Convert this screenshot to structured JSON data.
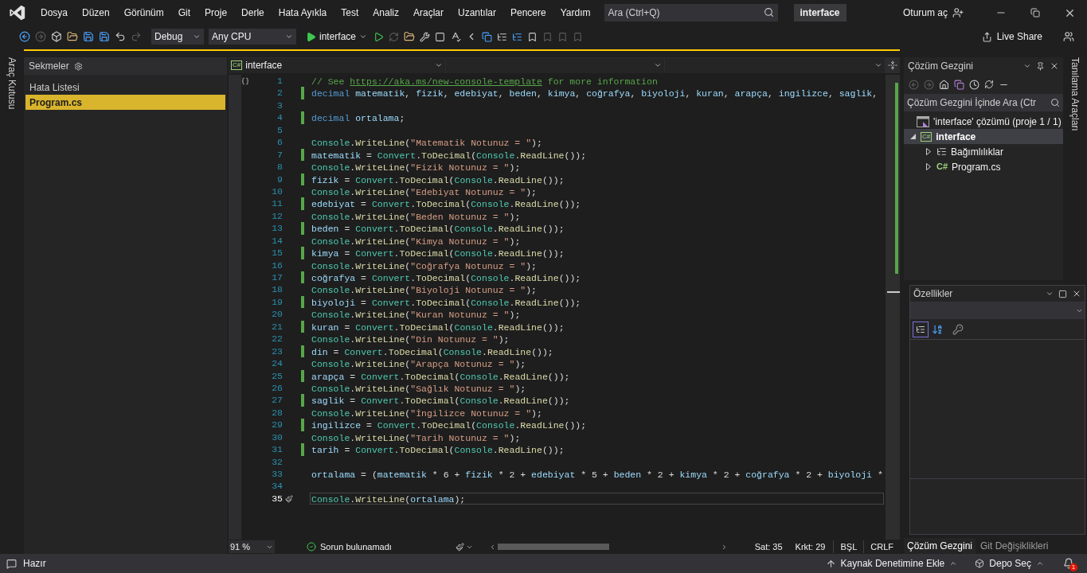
{
  "menu": [
    "Dosya",
    "Düzen",
    "Görünüm",
    "Git",
    "Proje",
    "Derle",
    "Hata Ayıkla",
    "Test",
    "Analiz",
    "Araçlar",
    "Uzantılar",
    "Pencere",
    "Yardım"
  ],
  "search": {
    "placeholder": "Ara (Ctrl+Q)"
  },
  "solution_name": "interface",
  "sign_in": "Oturum aç",
  "toolbar": {
    "configuration": "Debug",
    "platform": "Any CPU",
    "run_target": "interface",
    "live_share": "Live Share"
  },
  "left_rail": {
    "label": "Araç Kutusu"
  },
  "tabs_panel": {
    "title": "Sekmeler",
    "items": [
      {
        "label": "Hata Listesi",
        "selected": false
      },
      {
        "label": "Program.cs",
        "selected": true
      }
    ]
  },
  "editor": {
    "file_icon": "C#",
    "file": "interface",
    "lines": [
      {
        "number": "1",
        "changed": false,
        "current": false,
        "tokens": [
          {
            "kind": "comment",
            "text": "// See "
          },
          {
            "kind": "link",
            "text": "https://aka.ms/new-console-template"
          },
          {
            "kind": "comment",
            "text": " for more information"
          }
        ]
      },
      {
        "number": "2",
        "changed": true,
        "current": false,
        "tokens": [
          {
            "kind": "kw",
            "text": "decimal"
          },
          {
            "kind": "var",
            "text": "matematik"
          },
          {
            "kind": "punct",
            "text": ", "
          },
          {
            "kind": "var",
            "text": "fizik"
          },
          {
            "kind": "punct",
            "text": ", "
          },
          {
            "kind": "var",
            "text": "edebiyat"
          },
          {
            "kind": "punct",
            "text": ", "
          },
          {
            "kind": "var",
            "text": "beden"
          },
          {
            "kind": "punct",
            "text": ", "
          },
          {
            "kind": "var",
            "text": "kimya"
          },
          {
            "kind": "punct",
            "text": ", "
          },
          {
            "kind": "var",
            "text": "coğrafya"
          },
          {
            "kind": "punct",
            "text": ", "
          },
          {
            "kind": "var",
            "text": "biyoloji"
          },
          {
            "kind": "punct",
            "text": ", "
          },
          {
            "kind": "var",
            "text": "kuran"
          },
          {
            "kind": "punct",
            "text": ", "
          },
          {
            "kind": "var",
            "text": "arapça"
          },
          {
            "kind": "punct",
            "text": ", "
          },
          {
            "kind": "var",
            "text": "ingilizce"
          },
          {
            "kind": "punct",
            "text": ", "
          },
          {
            "kind": "var",
            "text": "saglik"
          },
          {
            "kind": "punct",
            "text": ","
          }
        ]
      },
      {
        "number": "3",
        "changed": false,
        "current": false
      },
      {
        "number": "4",
        "changed": true,
        "current": false,
        "tokens": [
          {
            "kind": "kw",
            "text": "decimal"
          },
          {
            "kind": "var",
            "text": "ortalama"
          },
          {
            "kind": "punct",
            "text": ";"
          }
        ]
      },
      {
        "number": "5",
        "changed": false,
        "current": false
      },
      {
        "number": "6",
        "changed": false,
        "current": false,
        "tokens": [
          {
            "kind": "type",
            "text": "Console"
          },
          {
            "kind": "punct",
            "text": "."
          },
          {
            "kind": "method",
            "text": "WriteLine"
          },
          {
            "kind": "punct",
            "text": "("
          },
          {
            "kind": "str",
            "text": "\"Matematik Notunuz = \""
          },
          {
            "kind": "punct",
            "text": ");"
          }
        ]
      },
      {
        "number": "7",
        "changed": true,
        "current": false,
        "tokens": [
          {
            "kind": "var",
            "text": "matematik"
          },
          {
            "kind": "punct",
            "text": " = "
          },
          {
            "kind": "type",
            "text": "Convert"
          },
          {
            "kind": "punct",
            "text": "."
          },
          {
            "kind": "method",
            "text": "ToDecimal"
          },
          {
            "kind": "punct",
            "text": "("
          },
          {
            "kind": "type",
            "text": "Console"
          },
          {
            "kind": "punct",
            "text": "."
          },
          {
            "kind": "method",
            "text": "ReadLine"
          },
          {
            "kind": "punct",
            "text": "());"
          }
        ]
      },
      {
        "number": "8",
        "changed": false,
        "current": false,
        "tokens": [
          {
            "kind": "type",
            "text": "Console"
          },
          {
            "kind": "punct",
            "text": "."
          },
          {
            "kind": "method",
            "text": "WriteLine"
          },
          {
            "kind": "punct",
            "text": "("
          },
          {
            "kind": "str",
            "text": "\"Fizik Notunuz = \""
          },
          {
            "kind": "punct",
            "text": ");"
          }
        ]
      },
      {
        "number": "9",
        "changed": true,
        "current": false,
        "tokens": [
          {
            "kind": "var",
            "text": "fizik"
          },
          {
            "kind": "punct",
            "text": " = "
          },
          {
            "kind": "type",
            "text": "Convert"
          },
          {
            "kind": "punct",
            "text": "."
          },
          {
            "kind": "method",
            "text": "ToDecimal"
          },
          {
            "kind": "punct",
            "text": "("
          },
          {
            "kind": "type",
            "text": "Console"
          },
          {
            "kind": "punct",
            "text": "."
          },
          {
            "kind": "method",
            "text": "ReadLine"
          },
          {
            "kind": "punct",
            "text": "());"
          }
        ]
      },
      {
        "number": "10",
        "changed": false,
        "current": false,
        "tokens": [
          {
            "kind": "type",
            "text": "Console"
          },
          {
            "kind": "punct",
            "text": "."
          },
          {
            "kind": "method",
            "text": "WriteLine"
          },
          {
            "kind": "punct",
            "text": "("
          },
          {
            "kind": "str",
            "text": "\"Edebiyat Notunuz = \""
          },
          {
            "kind": "punct",
            "text": ");"
          }
        ]
      },
      {
        "number": "11",
        "changed": true,
        "current": false,
        "tokens": [
          {
            "kind": "var",
            "text": "edebiyat"
          },
          {
            "kind": "punct",
            "text": " = "
          },
          {
            "kind": "type",
            "text": "Convert"
          },
          {
            "kind": "punct",
            "text": "."
          },
          {
            "kind": "method",
            "text": "ToDecimal"
          },
          {
            "kind": "punct",
            "text": "("
          },
          {
            "kind": "type",
            "text": "Console"
          },
          {
            "kind": "punct",
            "text": "."
          },
          {
            "kind": "method",
            "text": "ReadLine"
          },
          {
            "kind": "punct",
            "text": "());"
          }
        ]
      },
      {
        "number": "12",
        "changed": false,
        "current": false,
        "tokens": [
          {
            "kind": "type",
            "text": "Console"
          },
          {
            "kind": "punct",
            "text": "."
          },
          {
            "kind": "method",
            "text": "WriteLine"
          },
          {
            "kind": "punct",
            "text": "("
          },
          {
            "kind": "str",
            "text": "\"Beden Notunuz = \""
          },
          {
            "kind": "punct",
            "text": ");"
          }
        ]
      },
      {
        "number": "13",
        "changed": true,
        "current": false,
        "tokens": [
          {
            "kind": "var",
            "text": "beden"
          },
          {
            "kind": "punct",
            "text": " = "
          },
          {
            "kind": "type",
            "text": "Convert"
          },
          {
            "kind": "punct",
            "text": "."
          },
          {
            "kind": "method",
            "text": "ToDecimal"
          },
          {
            "kind": "punct",
            "text": "("
          },
          {
            "kind": "type",
            "text": "Console"
          },
          {
            "kind": "punct",
            "text": "."
          },
          {
            "kind": "method",
            "text": "ReadLine"
          },
          {
            "kind": "punct",
            "text": "());"
          }
        ]
      },
      {
        "number": "14",
        "changed": false,
        "current": false,
        "tokens": [
          {
            "kind": "type",
            "text": "Console"
          },
          {
            "kind": "punct",
            "text": "."
          },
          {
            "kind": "method",
            "text": "WriteLine"
          },
          {
            "kind": "punct",
            "text": "("
          },
          {
            "kind": "str",
            "text": "\"Kimya Notunuz = \""
          },
          {
            "kind": "punct",
            "text": ");"
          }
        ]
      },
      {
        "number": "15",
        "changed": true,
        "current": false,
        "tokens": [
          {
            "kind": "var",
            "text": "kimya"
          },
          {
            "kind": "punct",
            "text": " = "
          },
          {
            "kind": "type",
            "text": "Convert"
          },
          {
            "kind": "punct",
            "text": "."
          },
          {
            "kind": "method",
            "text": "ToDecimal"
          },
          {
            "kind": "punct",
            "text": "("
          },
          {
            "kind": "type",
            "text": "Console"
          },
          {
            "kind": "punct",
            "text": "."
          },
          {
            "kind": "method",
            "text": "ReadLine"
          },
          {
            "kind": "punct",
            "text": "());"
          }
        ]
      },
      {
        "number": "16",
        "changed": false,
        "current": false,
        "tokens": [
          {
            "kind": "type",
            "text": "Console"
          },
          {
            "kind": "punct",
            "text": "."
          },
          {
            "kind": "method",
            "text": "WriteLine"
          },
          {
            "kind": "punct",
            "text": "("
          },
          {
            "kind": "str",
            "text": "\"Coğrafya Notunuz = \""
          },
          {
            "kind": "punct",
            "text": ");"
          }
        ]
      },
      {
        "number": "17",
        "changed": true,
        "current": false,
        "tokens": [
          {
            "kind": "var",
            "text": "coğrafya"
          },
          {
            "kind": "punct",
            "text": " = "
          },
          {
            "kind": "type",
            "text": "Convert"
          },
          {
            "kind": "punct",
            "text": "."
          },
          {
            "kind": "method",
            "text": "ToDecimal"
          },
          {
            "kind": "punct",
            "text": "("
          },
          {
            "kind": "type",
            "text": "Console"
          },
          {
            "kind": "punct",
            "text": "."
          },
          {
            "kind": "method",
            "text": "ReadLine"
          },
          {
            "kind": "punct",
            "text": "());"
          }
        ]
      },
      {
        "number": "18",
        "changed": false,
        "current": false,
        "tokens": [
          {
            "kind": "type",
            "text": "Console"
          },
          {
            "kind": "punct",
            "text": "."
          },
          {
            "kind": "method",
            "text": "WriteLine"
          },
          {
            "kind": "punct",
            "text": "("
          },
          {
            "kind": "str",
            "text": "\"Biyoloji Notunuz = \""
          },
          {
            "kind": "punct",
            "text": ");"
          }
        ]
      },
      {
        "number": "19",
        "changed": true,
        "current": false,
        "tokens": [
          {
            "kind": "var",
            "text": "biyoloji"
          },
          {
            "kind": "punct",
            "text": " = "
          },
          {
            "kind": "type",
            "text": "Convert"
          },
          {
            "kind": "punct",
            "text": "."
          },
          {
            "kind": "method",
            "text": "ToDecimal"
          },
          {
            "kind": "punct",
            "text": "("
          },
          {
            "kind": "type",
            "text": "Console"
          },
          {
            "kind": "punct",
            "text": "."
          },
          {
            "kind": "method",
            "text": "ReadLine"
          },
          {
            "kind": "punct",
            "text": "());"
          }
        ]
      },
      {
        "number": "20",
        "changed": false,
        "current": false,
        "tokens": [
          {
            "kind": "type",
            "text": "Console"
          },
          {
            "kind": "punct",
            "text": "."
          },
          {
            "kind": "method",
            "text": "WriteLine"
          },
          {
            "kind": "punct",
            "text": "("
          },
          {
            "kind": "str",
            "text": "\"Kuran Notunuz = \""
          },
          {
            "kind": "punct",
            "text": ");"
          }
        ]
      },
      {
        "number": "21",
        "changed": true,
        "current": false,
        "tokens": [
          {
            "kind": "var",
            "text": "kuran"
          },
          {
            "kind": "punct",
            "text": " = "
          },
          {
            "kind": "type",
            "text": "Convert"
          },
          {
            "kind": "punct",
            "text": "."
          },
          {
            "kind": "method",
            "text": "ToDecimal"
          },
          {
            "kind": "punct",
            "text": "("
          },
          {
            "kind": "type",
            "text": "Console"
          },
          {
            "kind": "punct",
            "text": "."
          },
          {
            "kind": "method",
            "text": "ReadLine"
          },
          {
            "kind": "punct",
            "text": "());"
          }
        ]
      },
      {
        "number": "22",
        "changed": false,
        "current": false,
        "tokens": [
          {
            "kind": "type",
            "text": "Console"
          },
          {
            "kind": "punct",
            "text": "."
          },
          {
            "kind": "method",
            "text": "WriteLine"
          },
          {
            "kind": "punct",
            "text": "("
          },
          {
            "kind": "str",
            "text": "\"Din Notunuz = \""
          },
          {
            "kind": "punct",
            "text": ");"
          }
        ]
      },
      {
        "number": "23",
        "changed": true,
        "current": false,
        "tokens": [
          {
            "kind": "var",
            "text": "din"
          },
          {
            "kind": "punct",
            "text": " = "
          },
          {
            "kind": "type",
            "text": "Convert"
          },
          {
            "kind": "punct",
            "text": "."
          },
          {
            "kind": "method",
            "text": "ToDecimal"
          },
          {
            "kind": "punct",
            "text": "("
          },
          {
            "kind": "type",
            "text": "Console"
          },
          {
            "kind": "punct",
            "text": "."
          },
          {
            "kind": "method",
            "text": "ReadLine"
          },
          {
            "kind": "punct",
            "text": "());"
          }
        ]
      },
      {
        "number": "24",
        "changed": false,
        "current": false,
        "tokens": [
          {
            "kind": "type",
            "text": "Console"
          },
          {
            "kind": "punct",
            "text": "."
          },
          {
            "kind": "method",
            "text": "WriteLine"
          },
          {
            "kind": "punct",
            "text": "("
          },
          {
            "kind": "str",
            "text": "\"Arapça Notunuz = \""
          },
          {
            "kind": "punct",
            "text": ");"
          }
        ]
      },
      {
        "number": "25",
        "changed": true,
        "current": false,
        "tokens": [
          {
            "kind": "var",
            "text": "arapça"
          },
          {
            "kind": "punct",
            "text": " = "
          },
          {
            "kind": "type",
            "text": "Convert"
          },
          {
            "kind": "punct",
            "text": "."
          },
          {
            "kind": "method",
            "text": "ToDecimal"
          },
          {
            "kind": "punct",
            "text": "("
          },
          {
            "kind": "type",
            "text": "Console"
          },
          {
            "kind": "punct",
            "text": "."
          },
          {
            "kind": "method",
            "text": "ReadLine"
          },
          {
            "kind": "punct",
            "text": "());"
          }
        ]
      },
      {
        "number": "26",
        "changed": false,
        "current": false,
        "tokens": [
          {
            "kind": "type",
            "text": "Console"
          },
          {
            "kind": "punct",
            "text": "."
          },
          {
            "kind": "method",
            "text": "WriteLine"
          },
          {
            "kind": "punct",
            "text": "("
          },
          {
            "kind": "str",
            "text": "\"Sağlık Notunuz = \""
          },
          {
            "kind": "punct",
            "text": ");"
          }
        ]
      },
      {
        "number": "27",
        "changed": true,
        "current": false,
        "tokens": [
          {
            "kind": "var",
            "text": "saglik"
          },
          {
            "kind": "punct",
            "text": " = "
          },
          {
            "kind": "type",
            "text": "Convert"
          },
          {
            "kind": "punct",
            "text": "."
          },
          {
            "kind": "method",
            "text": "ToDecimal"
          },
          {
            "kind": "punct",
            "text": "("
          },
          {
            "kind": "type",
            "text": "Console"
          },
          {
            "kind": "punct",
            "text": "."
          },
          {
            "kind": "method",
            "text": "ReadLine"
          },
          {
            "kind": "punct",
            "text": "());"
          }
        ]
      },
      {
        "number": "28",
        "changed": false,
        "current": false,
        "tokens": [
          {
            "kind": "type",
            "text": "Console"
          },
          {
            "kind": "punct",
            "text": "."
          },
          {
            "kind": "method",
            "text": "WriteLine"
          },
          {
            "kind": "punct",
            "text": "("
          },
          {
            "kind": "str",
            "text": "\"İngilizce Notunuz = \""
          },
          {
            "kind": "punct",
            "text": ");"
          }
        ]
      },
      {
        "number": "29",
        "changed": true,
        "current": false,
        "tokens": [
          {
            "kind": "var",
            "text": "ingilizce"
          },
          {
            "kind": "punct",
            "text": " = "
          },
          {
            "kind": "type",
            "text": "Convert"
          },
          {
            "kind": "punct",
            "text": "."
          },
          {
            "kind": "method",
            "text": "ToDecimal"
          },
          {
            "kind": "punct",
            "text": "("
          },
          {
            "kind": "type",
            "text": "Console"
          },
          {
            "kind": "punct",
            "text": "."
          },
          {
            "kind": "method",
            "text": "ReadLine"
          },
          {
            "kind": "punct",
            "text": "());"
          }
        ]
      },
      {
        "number": "30",
        "changed": false,
        "current": false,
        "tokens": [
          {
            "kind": "type",
            "text": "Console"
          },
          {
            "kind": "punct",
            "text": "."
          },
          {
            "kind": "method",
            "text": "WriteLine"
          },
          {
            "kind": "punct",
            "text": "("
          },
          {
            "kind": "str",
            "text": "\"Tarih Notunuz = \""
          },
          {
            "kind": "punct",
            "text": ");"
          }
        ]
      },
      {
        "number": "31",
        "changed": true,
        "current": false,
        "tokens": [
          {
            "kind": "var",
            "text": "tarih"
          },
          {
            "kind": "punct",
            "text": " = "
          },
          {
            "kind": "type",
            "text": "Convert"
          },
          {
            "kind": "punct",
            "text": "."
          },
          {
            "kind": "method",
            "text": "ToDecimal"
          },
          {
            "kind": "punct",
            "text": "("
          },
          {
            "kind": "type",
            "text": "Console"
          },
          {
            "kind": "punct",
            "text": "."
          },
          {
            "kind": "method",
            "text": "ReadLine"
          },
          {
            "kind": "punct",
            "text": "());"
          }
        ]
      },
      {
        "number": "32",
        "changed": false,
        "current": false
      },
      {
        "number": "33",
        "changed": false,
        "current": false,
        "tokens": [
          {
            "kind": "var",
            "text": "ortalama"
          },
          {
            "kind": "punct",
            "text": " = ("
          },
          {
            "kind": "var",
            "text": "matematik"
          },
          {
            "kind": "punct",
            "text": " * 6 + "
          },
          {
            "kind": "var",
            "text": "fizik"
          },
          {
            "kind": "punct",
            "text": " * 2 + "
          },
          {
            "kind": "var",
            "text": "edebiyat"
          },
          {
            "kind": "punct",
            "text": " * 5 + "
          },
          {
            "kind": "var",
            "text": "beden"
          },
          {
            "kind": "punct",
            "text": " * 2 + "
          },
          {
            "kind": "var",
            "text": "kimya"
          },
          {
            "kind": "punct",
            "text": " * 2 + "
          },
          {
            "kind": "var",
            "text": "coğrafya"
          },
          {
            "kind": "punct",
            "text": " * 2 + "
          },
          {
            "kind": "var",
            "text": "biyoloji"
          },
          {
            "kind": "punct",
            "text": " *"
          }
        ]
      },
      {
        "number": "34",
        "changed": false,
        "current": false
      },
      {
        "number": "35",
        "changed": false,
        "current": true,
        "tokens": [
          {
            "kind": "type",
            "text": "Console"
          },
          {
            "kind": "punct",
            "text": "."
          },
          {
            "kind": "method",
            "text": "WriteLine"
          },
          {
            "kind": "punct",
            "text": "("
          },
          {
            "kind": "var",
            "text": "ortalama"
          },
          {
            "kind": "punct",
            "text": ");"
          }
        ]
      }
    ],
    "zoom": "91 %",
    "issues": "Sorun bulunamadı",
    "line_pos": "Sat: 35",
    "col_pos": "Krkt: 29",
    "insert_mode": "BŞL",
    "line_ending": "CRLF"
  },
  "solution_explorer": {
    "title": "Çözüm Gezgini",
    "search_placeholder": "Çözüm Gezgini İçinde Ara (Ctr",
    "tree": [
      {
        "kind": "solution",
        "label": "'interface' çözümü (proje 1 / 1)",
        "selected": false,
        "children": [
          {
            "kind": "project",
            "icon_text": "C#",
            "label": "interface",
            "selected": true,
            "expanded": true,
            "children": [
              {
                "kind": "dependencies",
                "label": "Bağımlılıklar",
                "selected": false,
                "expanded": false
              },
              {
                "kind": "csharp",
                "icon_text": "C#",
                "label": "Program.cs",
                "selected": false,
                "expanded": false
              }
            ]
          }
        ]
      }
    ]
  },
  "right_rail": {
    "label": "Tanılama Araçları"
  },
  "properties": {
    "title": "Özellikler"
  },
  "bottom_tabs": [
    {
      "label": "Çözüm Gezgini",
      "selected": true
    },
    {
      "label": "Git Değişiklikleri",
      "selected": false
    }
  ],
  "status_bar": {
    "state": "Hazır",
    "source_control": "Kaynak Denetimine Ekle",
    "repository": "Depo Seç",
    "notifications": "1"
  }
}
